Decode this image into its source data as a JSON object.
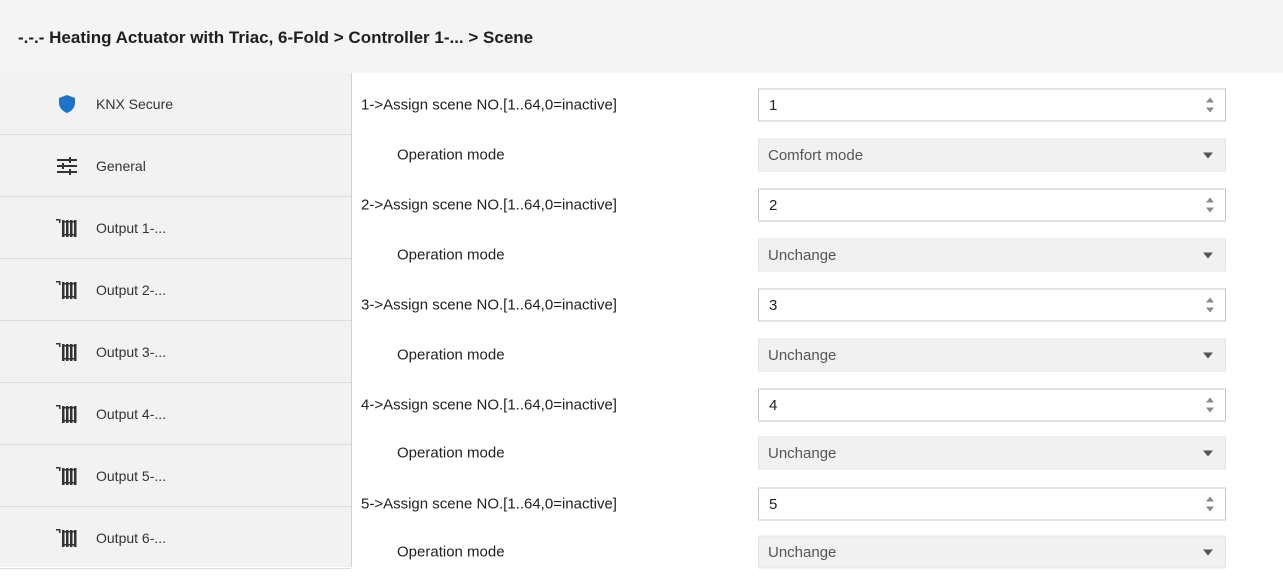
{
  "header": {
    "breadcrumb": "-.-.- Heating Actuator with Triac, 6-Fold > Controller 1-... > Scene"
  },
  "sidebar": {
    "items": [
      {
        "label": "KNX Secure",
        "icon": "shield-icon"
      },
      {
        "label": "General",
        "icon": "sliders-icon"
      },
      {
        "label": "Output 1-...",
        "icon": "radiator-icon"
      },
      {
        "label": "Output 2-...",
        "icon": "radiator-icon"
      },
      {
        "label": "Output 3-...",
        "icon": "radiator-icon"
      },
      {
        "label": "Output 4-...",
        "icon": "radiator-icon"
      },
      {
        "label": "Output 5-...",
        "icon": "radiator-icon"
      },
      {
        "label": "Output 6-...",
        "icon": "radiator-icon"
      }
    ]
  },
  "params": {
    "scene_label_1": "1->Assign scene NO.[1..64,0=inactive]",
    "scene_value_1": "1",
    "mode_label_1": "Operation mode",
    "mode_value_1": "Comfort mode",
    "scene_label_2": "2->Assign scene NO.[1..64,0=inactive]",
    "scene_value_2": "2",
    "mode_label_2": "Operation mode",
    "mode_value_2": "Unchange",
    "scene_label_3": "3->Assign scene NO.[1..64,0=inactive]",
    "scene_value_3": "3",
    "mode_label_3": "Operation mode",
    "mode_value_3": "Unchange",
    "scene_label_4": "4->Assign scene NO.[1..64,0=inactive]",
    "scene_value_4": "4",
    "mode_label_4": "Operation mode",
    "mode_value_4": "Unchange",
    "scene_label_5": "5->Assign scene NO.[1..64,0=inactive]",
    "scene_value_5": "5",
    "mode_label_5": "Operation mode",
    "mode_value_5": "Unchange"
  },
  "colors": {
    "shield": "#1e73c9",
    "header_bg": "#f4f4f4",
    "sidebar_bg": "#f2f2f2",
    "dropdown_bg": "#f1f1f1"
  }
}
